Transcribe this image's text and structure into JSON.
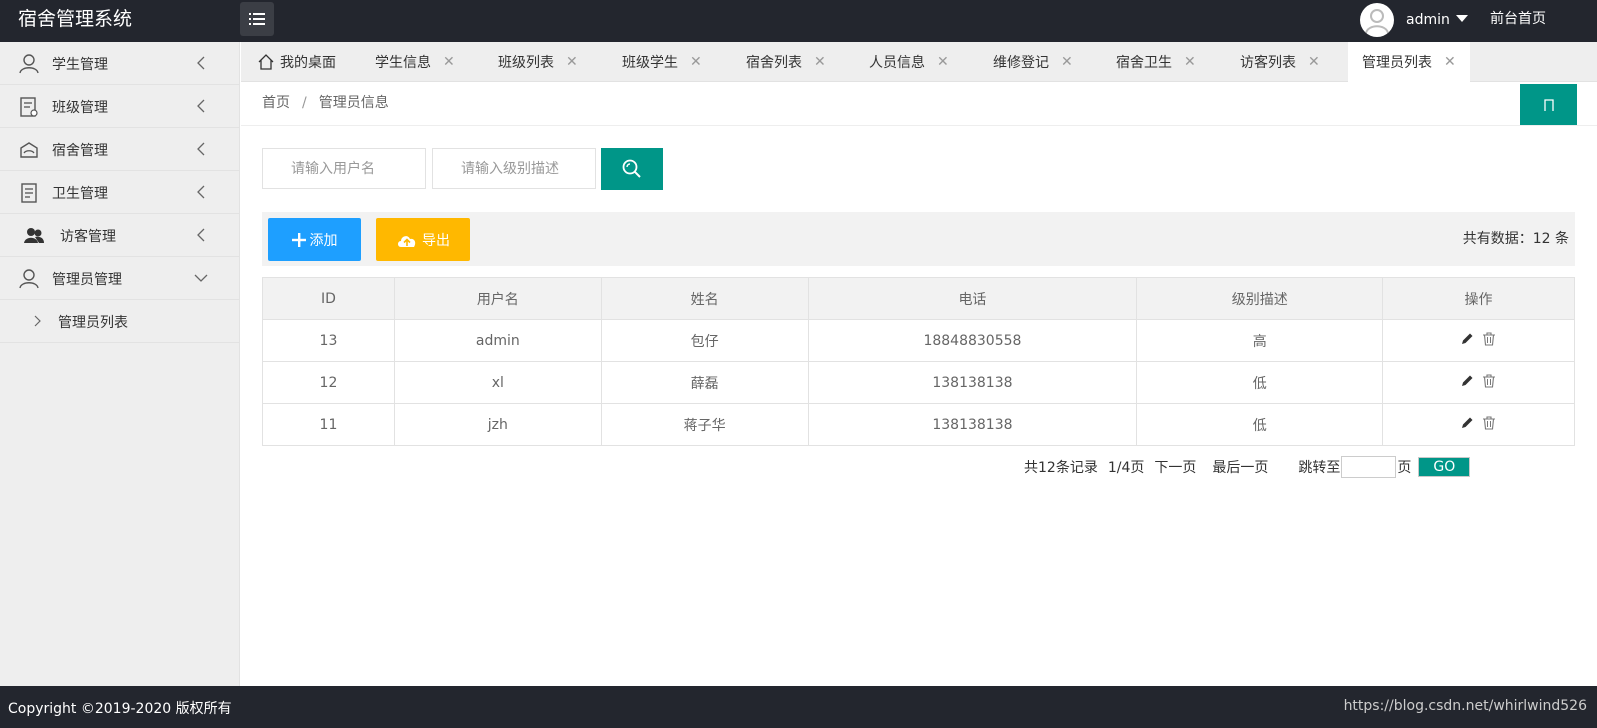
{
  "header": {
    "title": "宿舍管理系统",
    "user_name": "admin",
    "front_link": "前台首页"
  },
  "sidebar": {
    "items": [
      {
        "label": "学生管理",
        "icon": "user-icon"
      },
      {
        "label": "班级管理",
        "icon": "class-icon"
      },
      {
        "label": "宿舍管理",
        "icon": "dorm-icon"
      },
      {
        "label": "卫生管理",
        "icon": "clipboard-icon"
      },
      {
        "label": "访客管理",
        "icon": "users-icon"
      },
      {
        "label": "管理员管理",
        "icon": "user-icon"
      }
    ],
    "sub_item": "管理员列表"
  },
  "tabs": [
    {
      "label": "我的桌面"
    },
    {
      "label": "学生信息"
    },
    {
      "label": "班级列表"
    },
    {
      "label": "班级学生"
    },
    {
      "label": "宿舍列表"
    },
    {
      "label": "人员信息"
    },
    {
      "label": "维修登记"
    },
    {
      "label": "宿舍卫生"
    },
    {
      "label": "访客列表"
    },
    {
      "label": "管理员列表"
    }
  ],
  "breadcrumb": {
    "home": "首页",
    "current": "管理员信息"
  },
  "search": {
    "username_placeholder": "请输入用户名",
    "level_placeholder": "请输入级别描述"
  },
  "toolbar": {
    "add_label": "添加",
    "export_label": "导出",
    "total": "共有数据：12 条"
  },
  "table": {
    "headers": [
      "ID",
      "用户名",
      "姓名",
      "电话",
      "级别描述",
      "操作"
    ],
    "rows": [
      {
        "id": "13",
        "username": "admin",
        "name": "包仔",
        "phone": "18848830558",
        "level": "高"
      },
      {
        "id": "12",
        "username": "xl",
        "name": "薛磊",
        "phone": "138138138",
        "level": "低"
      },
      {
        "id": "11",
        "username": "jzh",
        "name": "蒋子华",
        "phone": "138138138",
        "level": "低"
      }
    ]
  },
  "pagination": {
    "total": "共12条记录",
    "page": "1/4页",
    "next": "下一页",
    "last": "最后一页",
    "jump": "跳转至",
    "page_unit": "页",
    "go": "GO"
  },
  "footer": {
    "copyright": "Copyright ©2019-2020 版权所有",
    "watermark": "https://blog.csdn.net/whirlwind526"
  },
  "colors": {
    "header_bg": "#23262e",
    "accent": "#009688",
    "add_button": "#1e9fff",
    "export_button": "#ffb800"
  }
}
